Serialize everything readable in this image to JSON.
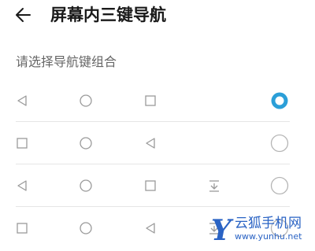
{
  "header": {
    "title": "屏幕内三键导航",
    "back_icon": "arrow-left-icon"
  },
  "section": {
    "label": "请选择导航键组合"
  },
  "options": [
    {
      "keys": [
        "back-triangle-icon",
        "home-circle-icon",
        "recents-square-icon"
      ],
      "selected": true
    },
    {
      "keys": [
        "recents-square-icon",
        "home-circle-icon",
        "back-triangle-icon"
      ],
      "selected": false
    },
    {
      "keys": [
        "back-triangle-icon",
        "home-circle-icon",
        "recents-square-icon",
        "notification-pulldown-icon"
      ],
      "selected": false
    },
    {
      "keys": [
        "recents-square-icon",
        "home-circle-icon",
        "back-triangle-icon",
        "notification-pulldown-icon"
      ],
      "selected": false
    }
  ],
  "colors": {
    "accent": "#2b9fd8",
    "icon_gray": "#9a9a9a",
    "radio_border": "#b5b5b5"
  },
  "watermark": {
    "letter": "Y",
    "brand": "云狐手机网",
    "url": "www.yunhu.net"
  }
}
